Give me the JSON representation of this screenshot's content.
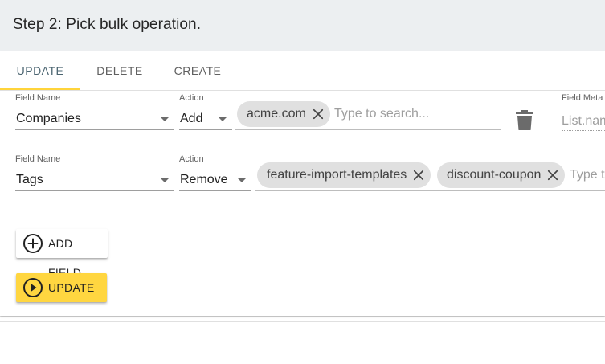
{
  "header": {
    "title": "Step 2: Pick bulk operation."
  },
  "tabs": [
    {
      "label": "UPDATE",
      "active": true
    },
    {
      "label": "DELETE",
      "active": false
    },
    {
      "label": "CREATE",
      "active": false
    }
  ],
  "rows": [
    {
      "field_label": "Field Name",
      "field_value": "Companies",
      "action_label": "Action",
      "action_value": "Add",
      "chips": [
        "acme.com"
      ],
      "search_placeholder": "Type to search...",
      "meta_label": "Field Meta",
      "meta_placeholder": "List.name"
    },
    {
      "field_label": "Field Name",
      "field_value": "Tags",
      "action_label": "Action",
      "action_value": "Remove",
      "chips": [
        "feature-import-templates",
        "discount-coupon"
      ],
      "search_placeholder": "Type t"
    }
  ],
  "buttons": {
    "add_field": "ADD FIELD",
    "update": "UPDATE"
  },
  "colors": {
    "accent_yellow": "#ffd640",
    "header_bg": "#eceff1",
    "chip_bg": "#e0e0e0",
    "active_tab": "#4a6470"
  },
  "icons": {
    "chip_remove": "close-icon",
    "delete_row": "trash-icon",
    "add_field": "plus-circle-icon",
    "update": "play-circle-icon"
  }
}
